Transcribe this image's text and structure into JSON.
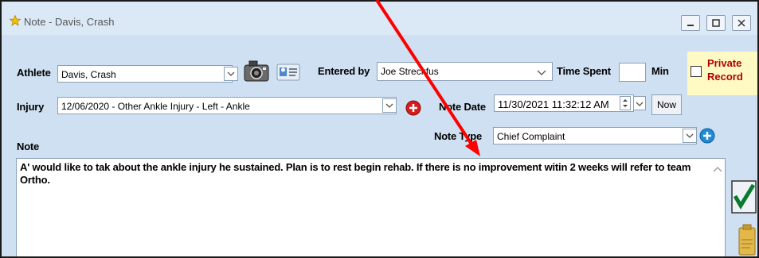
{
  "window": {
    "title": "Note - Davis, Crash"
  },
  "athlete": {
    "label": "Athlete",
    "value": "Davis, Crash"
  },
  "entered_by": {
    "label": "Entered by",
    "value": "Joe Streckfus"
  },
  "time_spent": {
    "label": "Time Spent",
    "value": "",
    "unit": "Min"
  },
  "private_record": {
    "label_line1": "Private",
    "label_line2": "Record",
    "checked": false
  },
  "injury": {
    "label": "Injury",
    "value": "12/06/2020 - Other Ankle Injury - Left - Ankle"
  },
  "note_date": {
    "label": "Note Date",
    "value": "11/30/2021 11:32:12 AM",
    "now_label": "Now"
  },
  "note_type": {
    "label": "Note Type",
    "value": "Chief Complaint"
  },
  "note": {
    "label": "Note",
    "text": "A' would like to tak about the ankle injury he sustained.  Plan is to rest   begin rehab.  If there is no improvement witin 2 weeks   will refer to team Ortho."
  },
  "colors": {
    "window_bg": "#cfe0f2",
    "private_bg": "#fff9c4",
    "private_text": "#b00000",
    "annotation_arrow": "#ff0000",
    "plus_button": "#1f8ad6",
    "remove_button": "#d81b1b"
  }
}
